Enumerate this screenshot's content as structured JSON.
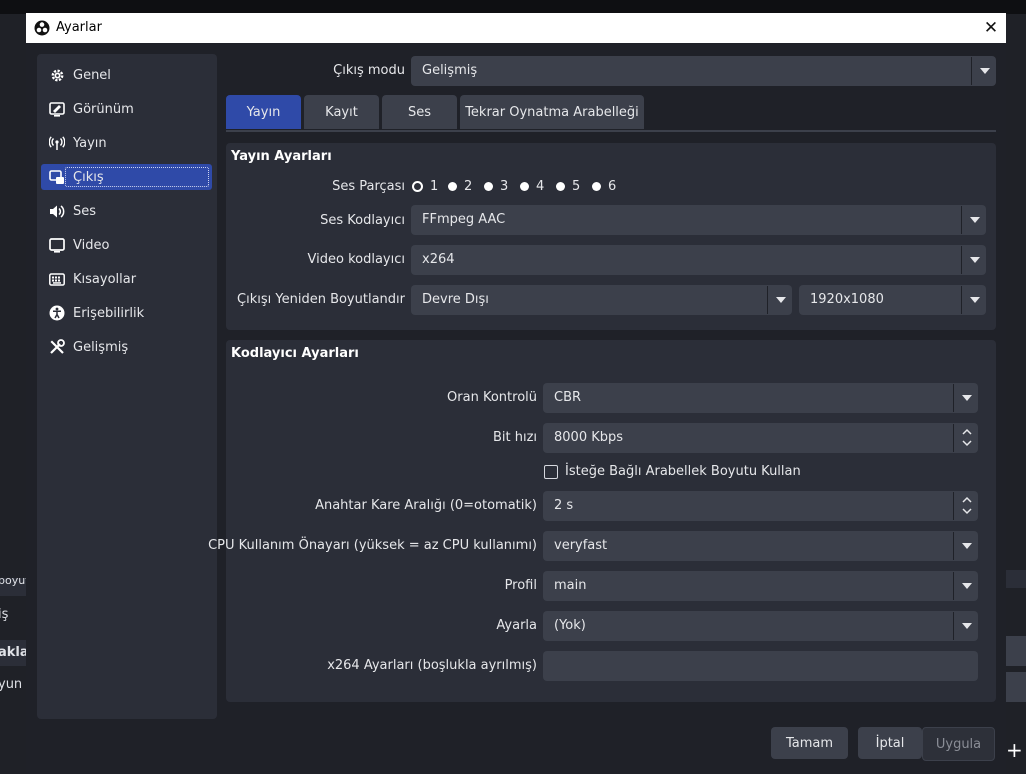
{
  "background": {
    "fragments": [
      "boyutla",
      "iş",
      "akla",
      "yun"
    ]
  },
  "window": {
    "title": "Ayarlar",
    "close_glyph": "✕"
  },
  "sidebar": {
    "items": [
      {
        "label": "Genel",
        "icon": "gear-icon"
      },
      {
        "label": "Görünüm",
        "icon": "appearance-icon"
      },
      {
        "label": "Yayın",
        "icon": "broadcast-antenna-icon"
      },
      {
        "label": "Çıkış",
        "icon": "output-icon",
        "active": true
      },
      {
        "label": "Ses",
        "icon": "speaker-icon"
      },
      {
        "label": "Video",
        "icon": "monitor-icon"
      },
      {
        "label": "Kısayollar",
        "icon": "keyboard-icon"
      },
      {
        "label": "Erişebilirlik",
        "icon": "accessibility-icon"
      },
      {
        "label": "Gelişmiş",
        "icon": "tools-icon"
      }
    ]
  },
  "output_mode": {
    "label": "Çıkış modu",
    "value": "Gelişmiş"
  },
  "tabs": [
    {
      "label": "Yayın",
      "active": true
    },
    {
      "label": "Kayıt"
    },
    {
      "label": "Ses"
    },
    {
      "label": "Tekrar Oynatma Arabelleği"
    }
  ],
  "stream_settings": {
    "title": "Yayın Ayarları",
    "audio_track": {
      "label": "Ses Parçası",
      "options": [
        "1",
        "2",
        "3",
        "4",
        "5",
        "6"
      ],
      "selected": "1"
    },
    "audio_encoder": {
      "label": "Ses Kodlayıcı",
      "value": "FFmpeg AAC"
    },
    "video_encoder": {
      "label": "Video kodlayıcı",
      "value": "x264"
    },
    "rescale": {
      "label": "Çıkışı Yeniden Boyutlandır",
      "value": "Devre Dışı",
      "resolution": "1920x1080"
    }
  },
  "encoder_settings": {
    "title": "Kodlayıcı Ayarları",
    "rate_control": {
      "label": "Oran Kontrolü",
      "value": "CBR"
    },
    "bitrate": {
      "label": "Bit hızı",
      "value": "8000 Kbps"
    },
    "custom_buffer": {
      "label": "İsteğe Bağlı Arabellek Boyutu Kullan",
      "checked": false
    },
    "keyframe": {
      "label": "Anahtar Kare Aralığı (0=otomatik)",
      "value": "2 s"
    },
    "cpu_preset": {
      "label": "CPU Kullanım Önayarı (yüksek = az CPU kullanımı)",
      "value": "veryfast"
    },
    "profile": {
      "label": "Profil",
      "value": "main"
    },
    "tune": {
      "label": "Ayarla",
      "value": "(Yok)"
    },
    "x264_options": {
      "label": "x264 Ayarları (boşlukla ayrılmış)",
      "value": ""
    }
  },
  "buttons": {
    "ok": "Tamam",
    "cancel": "İptal",
    "apply": "Uygula"
  },
  "colors": {
    "accent": "#2f4aa8",
    "panel": "#2b2e38",
    "control": "#3c404b",
    "window": "#1f2128"
  }
}
